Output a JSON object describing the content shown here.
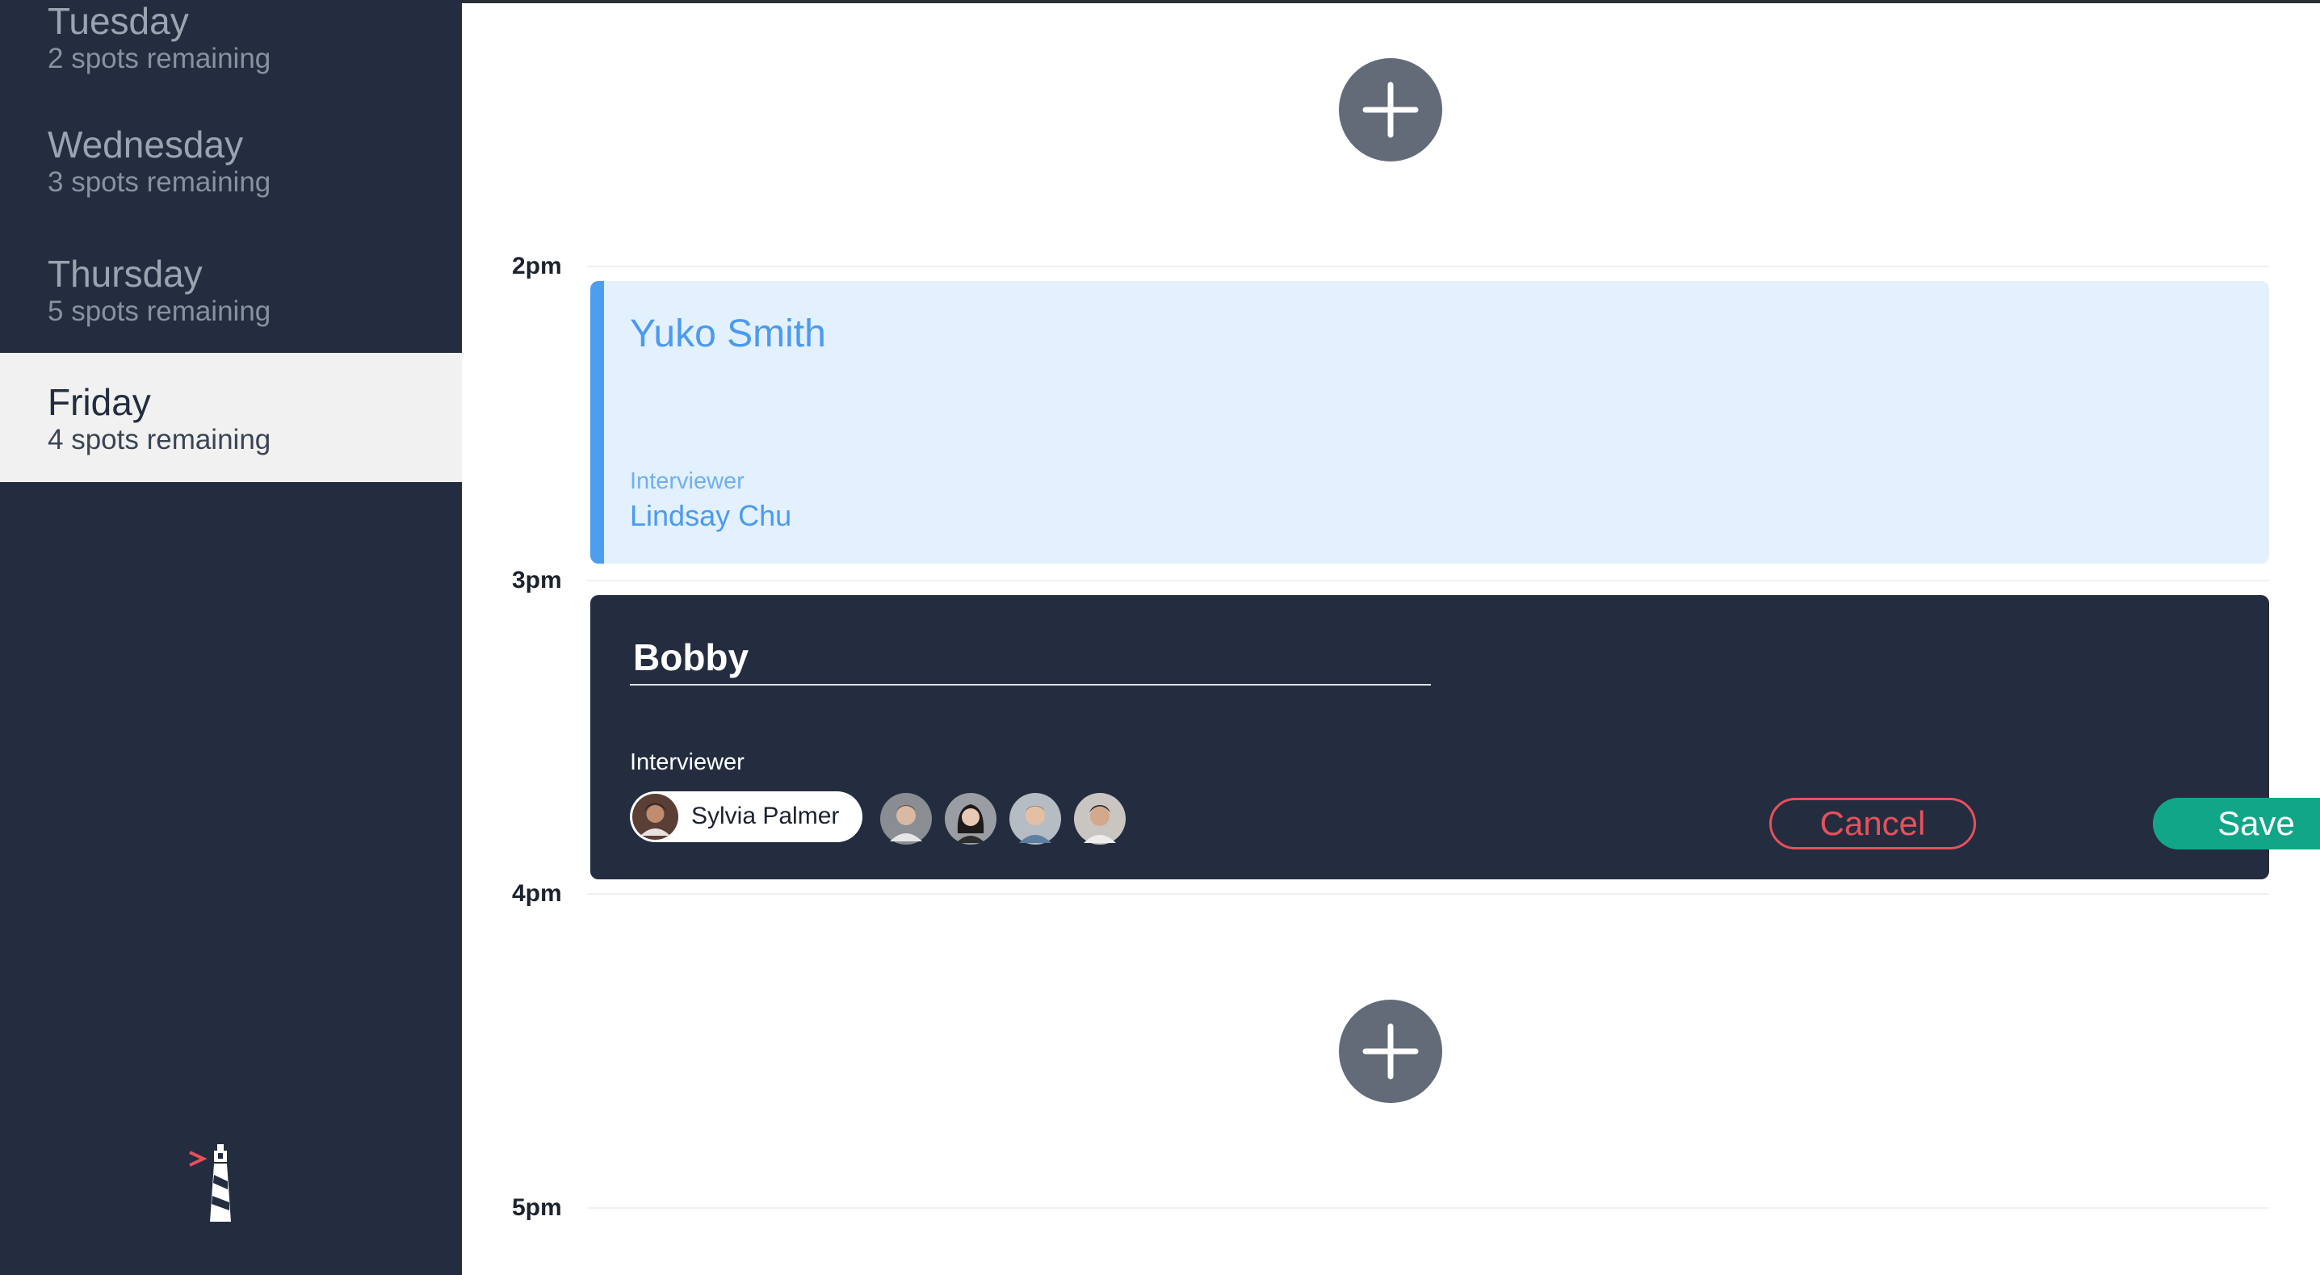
{
  "sidebar": {
    "days": [
      {
        "name": "Tuesday",
        "spots": "2 spots remaining",
        "active": false
      },
      {
        "name": "Wednesday",
        "spots": "3 spots remaining",
        "active": false
      },
      {
        "name": "Thursday",
        "spots": "5 spots remaining",
        "active": false
      },
      {
        "name": "Friday",
        "spots": "4 spots remaining",
        "active": true
      }
    ],
    "logo_icon": "lighthouse-logo"
  },
  "schedule": {
    "times": [
      "2pm",
      "3pm",
      "4pm",
      "5pm"
    ],
    "add_icon": "plus-icon",
    "booked_slot": {
      "candidate": "Yuko Smith",
      "interviewer_label": "Interviewer",
      "interviewer": "Lindsay Chu"
    },
    "edit_slot": {
      "candidate_value": "Bobby",
      "interviewer_label": "Interviewer",
      "selected_interviewer": "Sylvia Palmer",
      "cancel_label": "Cancel",
      "save_label": "Save"
    }
  },
  "colors": {
    "sidebar_bg": "#232d3f",
    "accent_blue": "#4a9af0",
    "cancel_red": "#e8505b",
    "save_green": "#12a689"
  }
}
